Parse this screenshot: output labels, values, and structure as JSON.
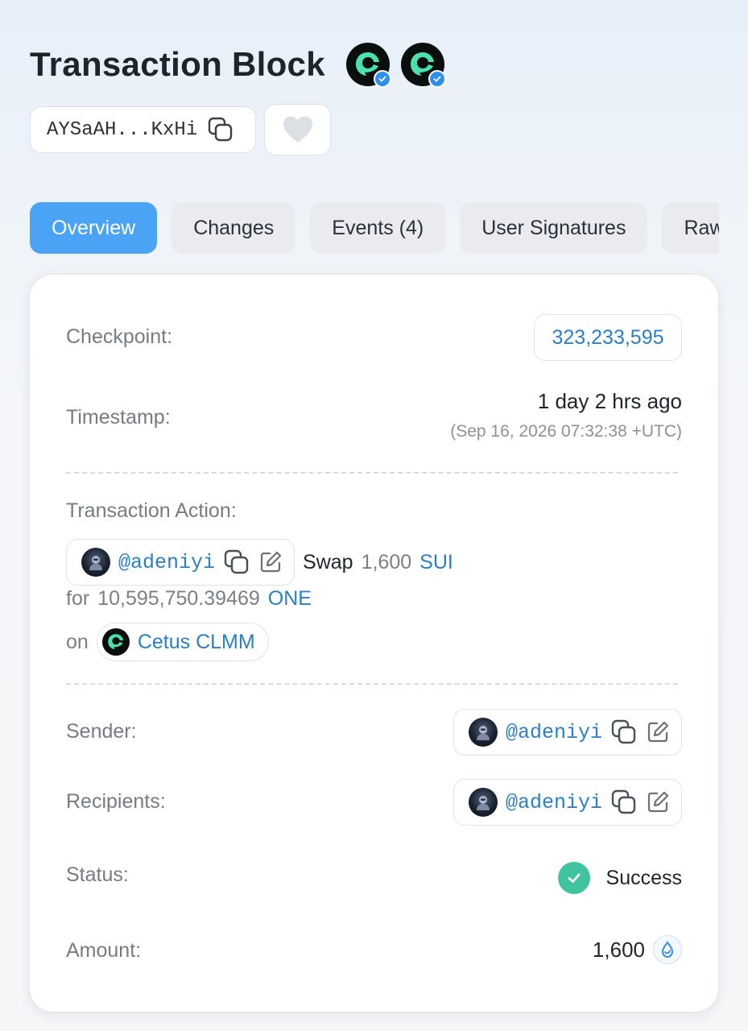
{
  "header": {
    "title": "Transaction Block",
    "digest": "AYSaAH...KxHi"
  },
  "tabs": [
    {
      "label": "Overview",
      "active": true
    },
    {
      "label": "Changes"
    },
    {
      "label": "Events (4)"
    },
    {
      "label": "User Signatures"
    },
    {
      "label": "Raw"
    }
  ],
  "overview": {
    "checkpoint_label": "Checkpoint:",
    "checkpoint_value": "323,233,595",
    "timestamp_label": "Timestamp:",
    "timestamp_relative": "1 day 2 hrs ago",
    "timestamp_absolute": "(Sep 16, 2026 07:32:38 +UTC)",
    "action_label": "Transaction Action:",
    "action": {
      "actor": "@adeniyi",
      "verb": "Swap",
      "amount_in": "1,600",
      "token_in": "SUI",
      "for_word": "for",
      "amount_out": "10,595,750.39469",
      "token_out": "ONE",
      "on_word": "on",
      "dex": "Cetus CLMM"
    },
    "sender_label": "Sender:",
    "sender": "@adeniyi",
    "recipients_label": "Recipients:",
    "recipient": "@adeniyi",
    "status_label": "Status:",
    "status": "Success",
    "amount_label": "Amount:",
    "amount": "1,600"
  },
  "colors": {
    "accent": "#4ba3f5",
    "link": "#2b7fc8",
    "success": "#3fc3a0",
    "cetus": "#4be0b0"
  },
  "icons": [
    "cetus-logo-icon",
    "verified-badge-icon",
    "copy-icon",
    "heart-icon",
    "edit-icon",
    "avatar-icon",
    "check-icon",
    "sui-drop-icon"
  ]
}
